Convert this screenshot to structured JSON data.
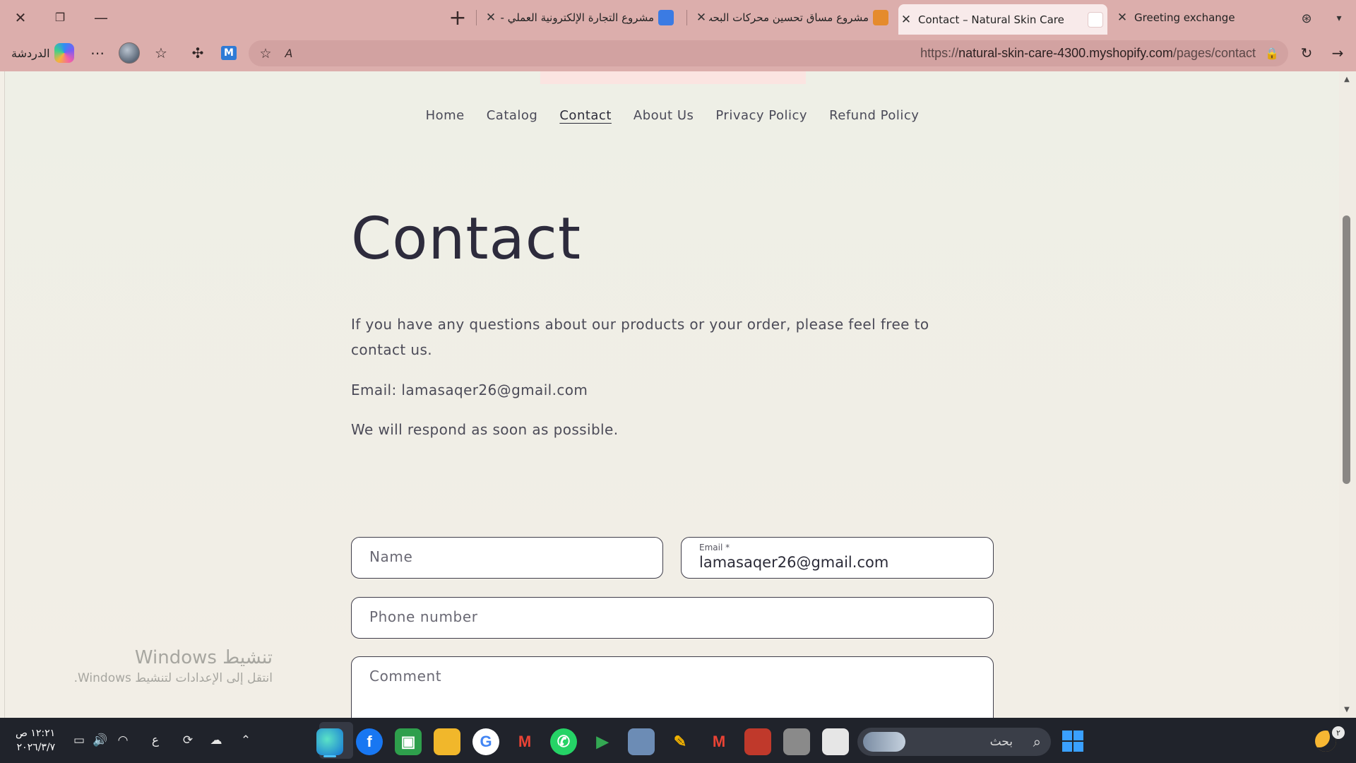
{
  "browser": {
    "tabs": [
      {
        "title": "Greeting exchange",
        "active": false,
        "favicon": "chatgpt-icon"
      },
      {
        "title": "Contact – Natural Skin Care",
        "active": true,
        "favicon": "shopify-store-icon"
      },
      {
        "title": "مشروع مساق تحسين محركات البحث",
        "active": false,
        "favicon": "slides-icon"
      },
      {
        "title": "مشروع التجارة الإلكترونية العملي - مس",
        "active": false,
        "favicon": "docs-icon"
      }
    ],
    "address": {
      "scheme": "https://",
      "host": "natural-skin-care-4300.myshopify.com",
      "path": "/pages/contact"
    },
    "copilot_label": "الدردشة"
  },
  "site": {
    "nav": [
      "Home",
      "Catalog",
      "Contact",
      "About Us",
      "Privacy Policy",
      "Refund Policy"
    ],
    "current_nav": "Contact",
    "title": "Contact",
    "intro": "If you have any questions about our products or your order, please feel free to contact us.",
    "email_line": "Email: lamasaqer26@gmail.com",
    "respond_line": "We will respond as soon as possible.",
    "form": {
      "name_placeholder": "Name",
      "email_label": "Email *",
      "email_value": "lamasaqer26@gmail.com",
      "phone_placeholder": "Phone number",
      "comment_placeholder": "Comment"
    }
  },
  "watermark": {
    "line1": "تنشيط Windows",
    "line2": "انتقل إلى الإعدادات لتنشيط Windows."
  },
  "taskbar": {
    "time": "١٢:٢١ ص",
    "date": "٢٠٢٦/٣/٧",
    "search_label": "بحث",
    "lang": "ع",
    "notif_count": "٢"
  },
  "colors": {
    "chrome": "#dcaeac",
    "page_bg": "#f2eee6",
    "heading": "#2d2b3c",
    "taskbar": "#20232b"
  }
}
